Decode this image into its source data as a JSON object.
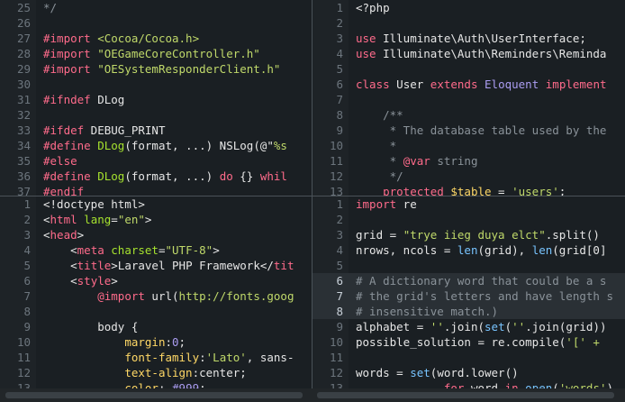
{
  "panes": {
    "top_left": {
      "start": 25,
      "lines": [
        [
          [
            "cm",
            "*/"
          ]
        ],
        [],
        [
          [
            "kw",
            "#import"
          ],
          [
            "wht",
            " "
          ],
          [
            "str",
            "<Cocoa/Cocoa.h>"
          ]
        ],
        [
          [
            "kw",
            "#import"
          ],
          [
            "wht",
            " "
          ],
          [
            "str",
            "\"OEGameCoreController.h\""
          ]
        ],
        [
          [
            "kw",
            "#import"
          ],
          [
            "wht",
            " "
          ],
          [
            "str",
            "\"OESystemResponderClient.h\""
          ]
        ],
        [],
        [
          [
            "kw",
            "#ifndef"
          ],
          [
            "wht",
            " DLog"
          ]
        ],
        [],
        [
          [
            "kw",
            "#ifdef"
          ],
          [
            "wht",
            " DEBUG_PRINT"
          ]
        ],
        [
          [
            "kw",
            "#define"
          ],
          [
            "wht",
            " "
          ],
          [
            "grn",
            "DLog"
          ],
          [
            "wht",
            "(format, ...) NSLog(@\""
          ],
          [
            "str",
            "%s"
          ]
        ],
        [
          [
            "kw",
            "#else"
          ]
        ],
        [
          [
            "kw",
            "#define"
          ],
          [
            "wht",
            " "
          ],
          [
            "grn",
            "DLog"
          ],
          [
            "wht",
            "(format, ...) "
          ],
          [
            "kw",
            "do"
          ],
          [
            "wht",
            " {} "
          ],
          [
            "kw",
            "whil"
          ]
        ],
        [
          [
            "kw",
            "#endif"
          ]
        ]
      ]
    },
    "top_right": {
      "start": 1,
      "lines": [
        [
          [
            "wht",
            "<?php"
          ]
        ],
        [],
        [
          [
            "kw",
            "use"
          ],
          [
            "wht",
            " Illuminate\\Auth\\UserInterface;"
          ]
        ],
        [
          [
            "kw",
            "use"
          ],
          [
            "wht",
            " Illuminate\\Auth\\Reminders\\Reminda"
          ]
        ],
        [],
        [
          [
            "kw",
            "class"
          ],
          [
            "wht",
            " User "
          ],
          [
            "kw",
            "extends"
          ],
          [
            "wht",
            " "
          ],
          [
            "prp",
            "Eloquent"
          ],
          [
            "wht",
            " "
          ],
          [
            "kw",
            "implement"
          ]
        ],
        [],
        [
          [
            "cm",
            "    /**"
          ]
        ],
        [
          [
            "cm",
            "     * The database table used by the"
          ]
        ],
        [
          [
            "cm",
            "     *"
          ]
        ],
        [
          [
            "cm",
            "     * "
          ],
          [
            "kw",
            "@var"
          ],
          [
            "cm",
            " string"
          ]
        ],
        [
          [
            "cm",
            "     */"
          ]
        ],
        [
          [
            "kw",
            "    protected"
          ],
          [
            "wht",
            " "
          ],
          [
            "yel",
            "$table"
          ],
          [
            "wht",
            " = "
          ],
          [
            "str",
            "'users'"
          ],
          [
            "wht",
            ";"
          ]
        ]
      ]
    },
    "bottom_left": {
      "start": 1,
      "lines": [
        [
          [
            "wht",
            "<!doctype html>"
          ]
        ],
        [
          [
            "wht",
            "<"
          ],
          [
            "tag",
            "html"
          ],
          [
            "wht",
            " "
          ],
          [
            "attr",
            "lang"
          ],
          [
            "wht",
            "="
          ],
          [
            "str",
            "\"en\""
          ],
          [
            "wht",
            ">"
          ]
        ],
        [
          [
            "wht",
            "<"
          ],
          [
            "tag",
            "head"
          ],
          [
            "wht",
            ">"
          ]
        ],
        [
          [
            "wht",
            "    <"
          ],
          [
            "tag",
            "meta"
          ],
          [
            "wht",
            " "
          ],
          [
            "attr",
            "charset"
          ],
          [
            "wht",
            "="
          ],
          [
            "str",
            "\"UTF-8\""
          ],
          [
            "wht",
            ">"
          ]
        ],
        [
          [
            "wht",
            "    <"
          ],
          [
            "tag",
            "title"
          ],
          [
            "wht",
            ">Laravel PHP Framework</"
          ],
          [
            "tag",
            "tit"
          ]
        ],
        [
          [
            "wht",
            "    <"
          ],
          [
            "tag",
            "style"
          ],
          [
            "wht",
            ">"
          ]
        ],
        [
          [
            "wht",
            "        "
          ],
          [
            "kw",
            "@import"
          ],
          [
            "wht",
            " url("
          ],
          [
            "str",
            "http://fonts.goog"
          ]
        ],
        [],
        [
          [
            "wht",
            "        body {"
          ]
        ],
        [
          [
            "wht",
            "            "
          ],
          [
            "yel",
            "margin"
          ],
          [
            "wht",
            ":"
          ],
          [
            "prp",
            "0"
          ],
          [
            "wht",
            ";"
          ]
        ],
        [
          [
            "wht",
            "            "
          ],
          [
            "yel",
            "font-family"
          ],
          [
            "wht",
            ":"
          ],
          [
            "str",
            "'Lato'"
          ],
          [
            "wht",
            ", sans-"
          ]
        ],
        [
          [
            "wht",
            "            "
          ],
          [
            "yel",
            "text-align"
          ],
          [
            "wht",
            ":center;"
          ]
        ],
        [
          [
            "wht",
            "            "
          ],
          [
            "yel",
            "color"
          ],
          [
            "wht",
            ": "
          ],
          [
            "prp",
            "#999"
          ],
          [
            "wht",
            ";"
          ]
        ]
      ]
    },
    "bottom_right": {
      "start": 1,
      "highlight": [
        6,
        8
      ],
      "lines": [
        [
          [
            "kw",
            "import"
          ],
          [
            "wht",
            " re"
          ]
        ],
        [],
        [
          [
            "wht",
            "grid = "
          ],
          [
            "str",
            "\"trye iieg duya elct\""
          ],
          [
            "wht",
            ".split()"
          ]
        ],
        [
          [
            "wht",
            "nrows, ncols = "
          ],
          [
            "blu",
            "len"
          ],
          [
            "wht",
            "(grid), "
          ],
          [
            "blu",
            "len"
          ],
          [
            "wht",
            "(grid[0]"
          ]
        ],
        [],
        [
          [
            "cm",
            "# A dictionary word that could be a s"
          ]
        ],
        [
          [
            "cm",
            "# the grid's letters and have length s"
          ]
        ],
        [
          [
            "cm",
            "# insensitive match.)"
          ]
        ],
        [
          [
            "wht",
            "alphabet = "
          ],
          [
            "str",
            "''"
          ],
          [
            "wht",
            ".join("
          ],
          [
            "blu",
            "set"
          ],
          [
            "wht",
            "("
          ],
          [
            "str",
            "''"
          ],
          [
            "wht",
            ".join(grid))"
          ]
        ],
        [
          [
            "wht",
            "possible_solution = re.compile("
          ],
          [
            "str",
            "'[' + "
          ]
        ],
        [],
        [
          [
            "wht",
            "words = "
          ],
          [
            "blu",
            "set"
          ],
          [
            "wht",
            "(word.lower()"
          ]
        ],
        [
          [
            "wht",
            "             "
          ],
          [
            "kw",
            "for"
          ],
          [
            "wht",
            " word "
          ],
          [
            "kw",
            "in"
          ],
          [
            "wht",
            " "
          ],
          [
            "blu",
            "open"
          ],
          [
            "wht",
            "("
          ],
          [
            "str",
            "'words'"
          ],
          [
            "wht",
            ")"
          ]
        ]
      ]
    }
  },
  "colors": {
    "background": "#1a1f23",
    "divider": "#4a5258",
    "gutter_text": "#6c757d"
  }
}
